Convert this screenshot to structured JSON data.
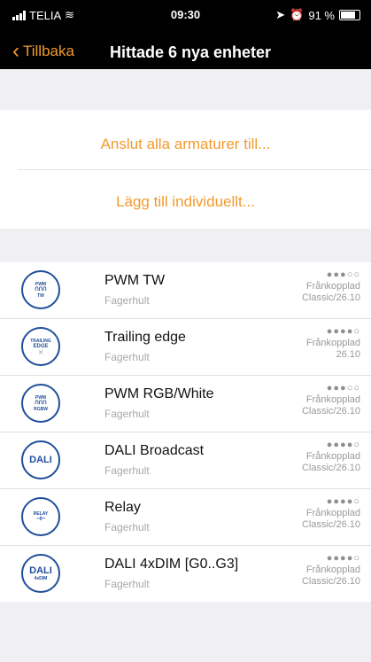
{
  "status_bar": {
    "carrier": "TELIA",
    "time": "09:30",
    "battery": "91 %",
    "battery_level": 0.91
  },
  "nav": {
    "back_label": "Tillbaka",
    "title": "Hittade 6 nya enheter"
  },
  "actions": {
    "connect_all": "Anslut alla armaturer till...",
    "add_individual": "Lägg till individuellt..."
  },
  "devices": [
    {
      "name": "PWM TW",
      "vendor": "Fagerhult",
      "signal": "●●●○○",
      "status": "Frånkopplad",
      "version": "Classic/26.10",
      "icon": {
        "top": "PWM",
        "mid": "ՈՈՈ",
        "bottom": "TW"
      }
    },
    {
      "name": "Trailing edge",
      "vendor": "Fagerhult",
      "signal": "●●●●○",
      "status": "Frånkopplad",
      "version": "26.10",
      "icon": {
        "top": "TRAILING",
        "mid": "EDGE",
        "bottom": "⤫"
      }
    },
    {
      "name": "PWM RGB/White",
      "vendor": "Fagerhult",
      "signal": "●●●○○",
      "status": "Frånkopplad",
      "version": "Classic/26.10",
      "icon": {
        "top": "PWM",
        "mid": "ՈՈՈ",
        "bottom": "RGBW"
      }
    },
    {
      "name": "DALI Broadcast",
      "vendor": "Fagerhult",
      "signal": "●●●●○",
      "status": "Frånkopplad",
      "version": "Classic/26.10",
      "icon": {
        "top": "",
        "mid": "DALI",
        "bottom": ""
      }
    },
    {
      "name": "Relay",
      "vendor": "Fagerhult",
      "signal": "●●●●○",
      "status": "Frånkopplad",
      "version": "Classic/26.10",
      "icon": {
        "top": "RELAY",
        "mid": "⊣⊢",
        "bottom": ""
      }
    },
    {
      "name": "DALI 4xDIM [G0..G3]",
      "vendor": "Fagerhult",
      "signal": "●●●●○",
      "status": "Frånkopplad",
      "version": "Classic/26.10",
      "icon": {
        "top": "",
        "mid": "DALI",
        "bottom": "4xDIM"
      }
    }
  ]
}
